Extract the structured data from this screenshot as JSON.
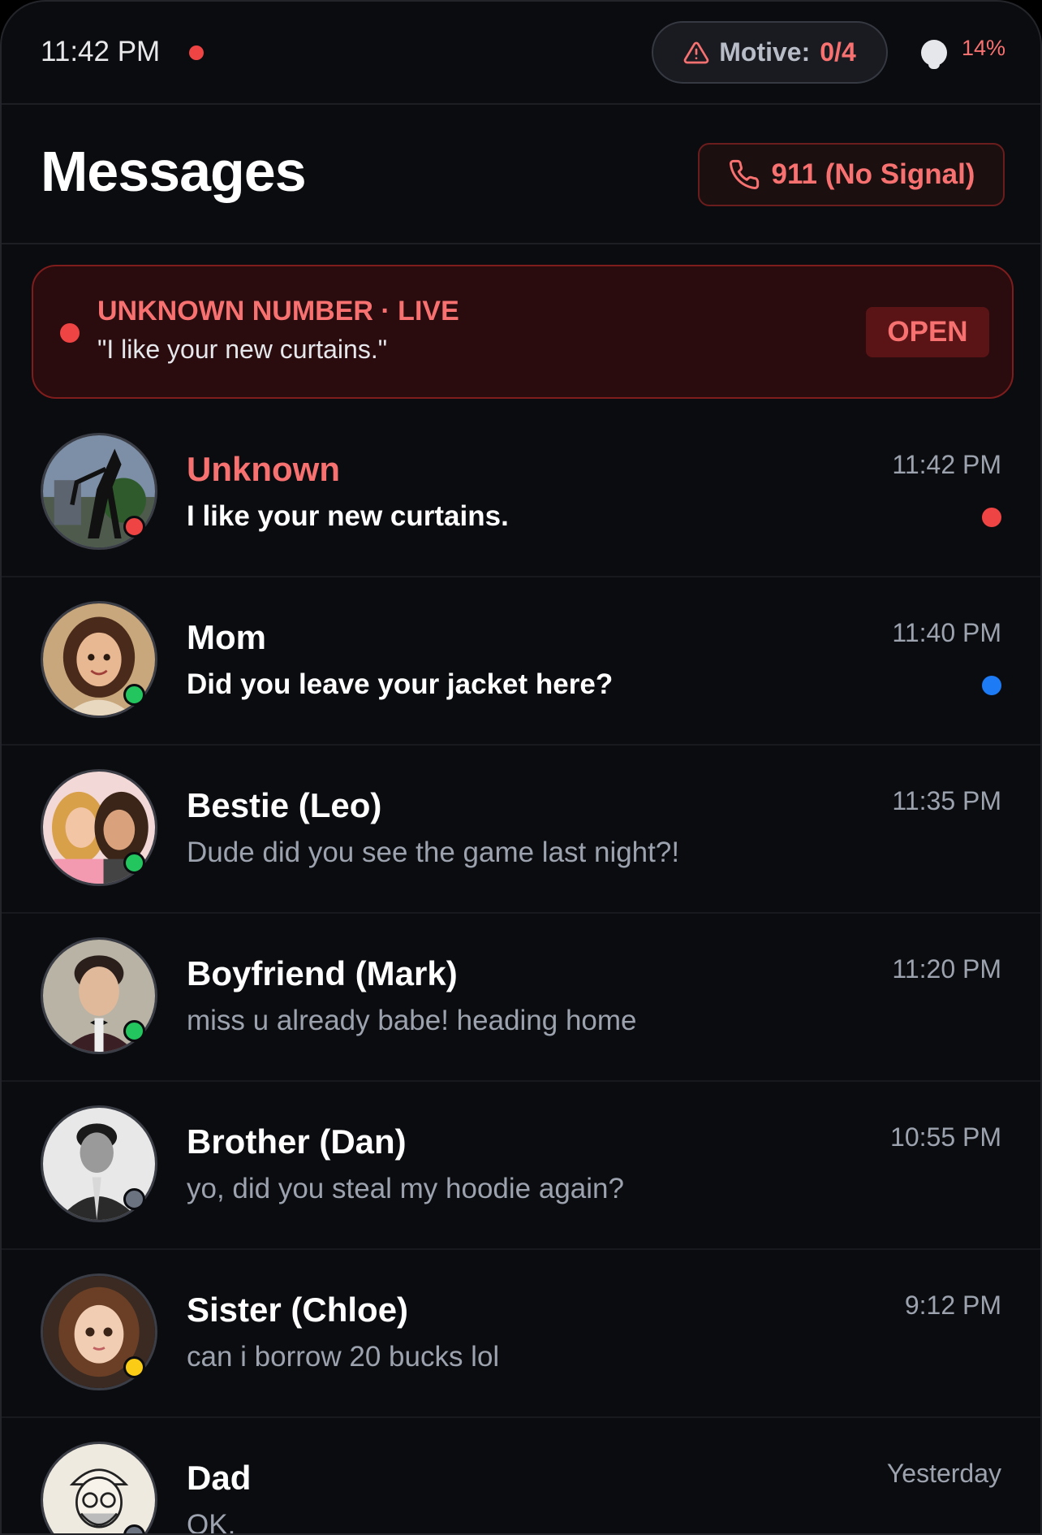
{
  "status_bar": {
    "time": "11:42 PM",
    "motive_label": "Motive:",
    "motive_value": "0/4",
    "battery": "14%"
  },
  "header": {
    "title": "Messages",
    "emergency_button": "911 (No Signal)"
  },
  "alert": {
    "heading": "UNKNOWN NUMBER · LIVE",
    "message": "\"I like your new curtains.\"",
    "action": "OPEN"
  },
  "conversations": [
    {
      "name": "Unknown",
      "preview": "I like your new curtains.",
      "time": "11:42 PM",
      "presence_color": "#ef4444",
      "unread_color": "#ef4444",
      "unread": true,
      "avatar_icon": "creature-avatar"
    },
    {
      "name": "Mom",
      "preview": "Did you leave your jacket here?",
      "time": "11:40 PM",
      "presence_color": "#22c55e",
      "unread_color": "#1d7bf5",
      "unread": true,
      "avatar_icon": "mom-avatar"
    },
    {
      "name": "Bestie (Leo)",
      "preview": "Dude did you see the game last night?!",
      "time": "11:35 PM",
      "presence_color": "#22c55e",
      "unread": false,
      "avatar_icon": "bestie-avatar"
    },
    {
      "name": "Boyfriend (Mark)",
      "preview": "miss u already babe! heading home",
      "time": "11:20 PM",
      "presence_color": "#22c55e",
      "unread": false,
      "avatar_icon": "mark-avatar"
    },
    {
      "name": "Brother (Dan)",
      "preview": "yo, did you steal my hoodie again?",
      "time": "10:55 PM",
      "presence_color": "#6b7280",
      "unread": false,
      "avatar_icon": "dan-avatar"
    },
    {
      "name": "Sister (Chloe)",
      "preview": "can i borrow 20 bucks lol",
      "time": "9:12 PM",
      "presence_color": "#facc15",
      "unread": false,
      "avatar_icon": "chloe-avatar"
    },
    {
      "name": "Dad",
      "preview": "OK.",
      "time": "Yesterday",
      "presence_color": "#6b7280",
      "unread": false,
      "avatar_icon": "dad-avatar"
    }
  ],
  "colors": {
    "accent_red": "#f87171",
    "background": "#0b0c0f",
    "unread_blue": "#1d7bf5"
  }
}
